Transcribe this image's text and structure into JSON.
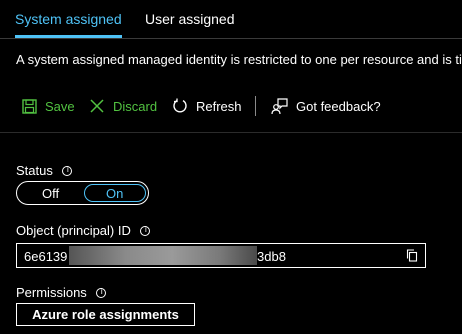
{
  "tabs": [
    {
      "label": "System assigned",
      "active": true
    },
    {
      "label": "User assigned",
      "active": false
    }
  ],
  "description": "A system assigned managed identity is restricted to one per resource and is tie",
  "toolbar": {
    "save_label": "Save",
    "discard_label": "Discard",
    "refresh_label": "Refresh",
    "feedback_label": "Got feedback?"
  },
  "status": {
    "label": "Status",
    "off_label": "Off",
    "on_label": "On",
    "selected": "On"
  },
  "object_id": {
    "label": "Object (principal) ID",
    "value_prefix": "6e6139",
    "value_suffix": "3db8"
  },
  "permissions": {
    "label": "Permissions",
    "button_label": "Azure role assignments"
  },
  "colors": {
    "accent": "#4fc3f7",
    "action_green": "#52c241",
    "background": "#000000",
    "text": "#ffffff"
  }
}
